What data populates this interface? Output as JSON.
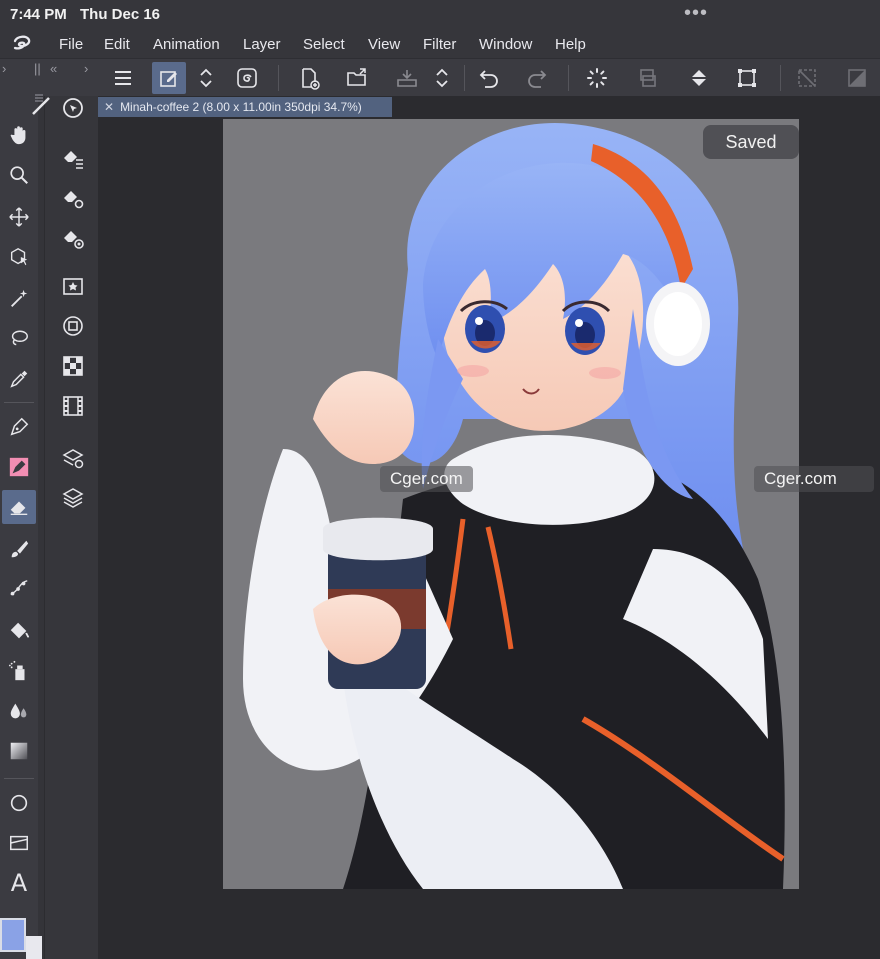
{
  "status": {
    "time": "7:44 PM",
    "date": "Thu Dec 16",
    "more": "•••"
  },
  "menu": [
    "File",
    "Edit",
    "Animation",
    "Layer",
    "Select",
    "View",
    "Filter",
    "Window",
    "Help"
  ],
  "toolbar": {
    "panel_toggle": "||",
    "collapse": "«",
    "expand": "›"
  },
  "document": {
    "close": "✕",
    "tab_label": "Minah-coffee 2 (8.00 x 11.00in 350dpi 34.7%)"
  },
  "canvas": {
    "status_badge": "Saved",
    "watermark_left": "Cger.com",
    "watermark_right": "Cger.com"
  },
  "tools": {
    "text_tool_glyph": "A"
  },
  "colors": {
    "accent_active": "#5a6b8c",
    "main_color": "#8aa2e6",
    "sub_color": "#e8e8ee",
    "hair": "#7e9cf0",
    "headband": "#e8602a"
  }
}
